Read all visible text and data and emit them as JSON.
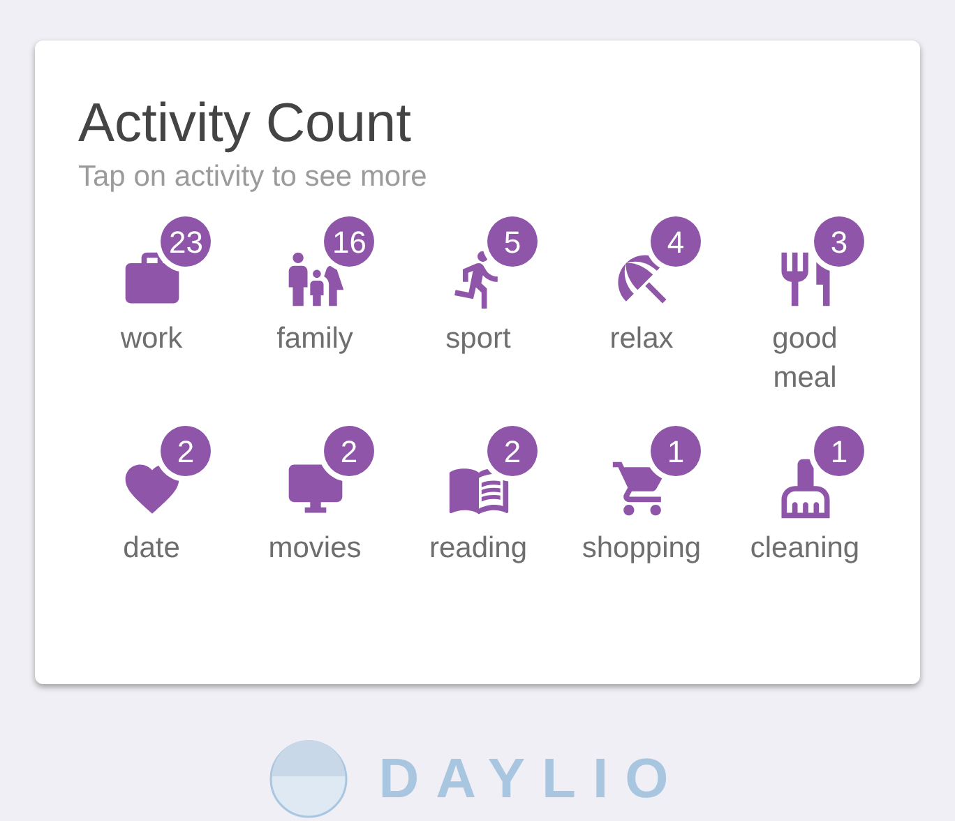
{
  "card": {
    "title": "Activity Count",
    "subtitle": "Tap on activity to see more"
  },
  "activities": [
    {
      "kind": "work",
      "label": "work",
      "count": "23"
    },
    {
      "kind": "family",
      "label": "family",
      "count": "16"
    },
    {
      "kind": "sport",
      "label": "sport",
      "count": "5"
    },
    {
      "kind": "relax",
      "label": "relax",
      "count": "4"
    },
    {
      "kind": "meal",
      "label": "good meal",
      "count": "3"
    },
    {
      "kind": "date",
      "label": "date",
      "count": "2"
    },
    {
      "kind": "movies",
      "label": "movies",
      "count": "2"
    },
    {
      "kind": "reading",
      "label": "reading",
      "count": "2"
    },
    {
      "kind": "shopping",
      "label": "shopping",
      "count": "1"
    },
    {
      "kind": "cleaning",
      "label": "cleaning",
      "count": "1"
    }
  ],
  "brand": {
    "name": "DAYLIO"
  }
}
